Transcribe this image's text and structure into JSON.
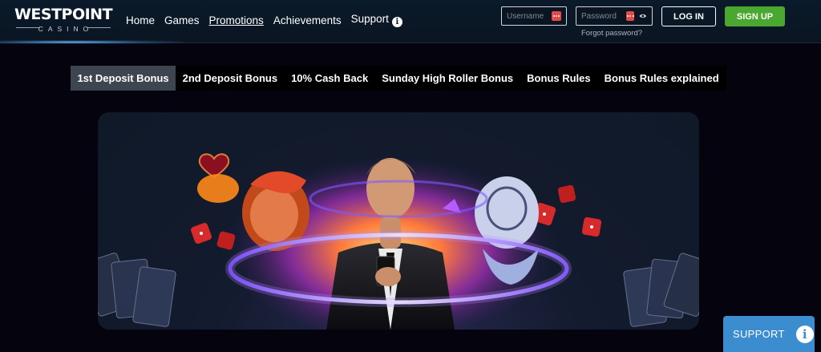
{
  "header": {
    "logo": {
      "main": "WESTPOINT",
      "sub": "CASINO"
    },
    "nav": [
      {
        "label": "Home",
        "active": false
      },
      {
        "label": "Games",
        "active": false
      },
      {
        "label": "Promotions",
        "active": true
      },
      {
        "label": "Achievements",
        "active": false
      },
      {
        "label": "Support",
        "active": false
      }
    ],
    "username_placeholder": "Username",
    "password_placeholder": "Password",
    "forgot_password": "Forgot password?",
    "login_label": "LOG IN",
    "signup_label": "SIGN UP"
  },
  "tabs": [
    {
      "label": "1st Deposit Bonus",
      "active": true
    },
    {
      "label": "2nd Deposit Bonus",
      "active": false
    },
    {
      "label": "10% Cash Back",
      "active": false
    },
    {
      "label": "Sunday High Roller Bonus",
      "active": false
    },
    {
      "label": "Bonus Rules",
      "active": false
    },
    {
      "label": "Bonus Rules explained",
      "active": false
    }
  ],
  "support_button": {
    "label": "SUPPORT"
  },
  "colors": {
    "header_bg": "#0b1522",
    "page_bg": "#05040e",
    "active_tab": "#3d4650",
    "signup_green": "#4aa830",
    "support_blue": "#3c8dd0",
    "badge_red": "#e04a4a"
  },
  "icons": {
    "support_nav": "info-icon",
    "username_field": "password-manager-icon",
    "password_field": "password-manager-icon",
    "password_toggle": "eye-icon",
    "support_button": "info-icon"
  }
}
